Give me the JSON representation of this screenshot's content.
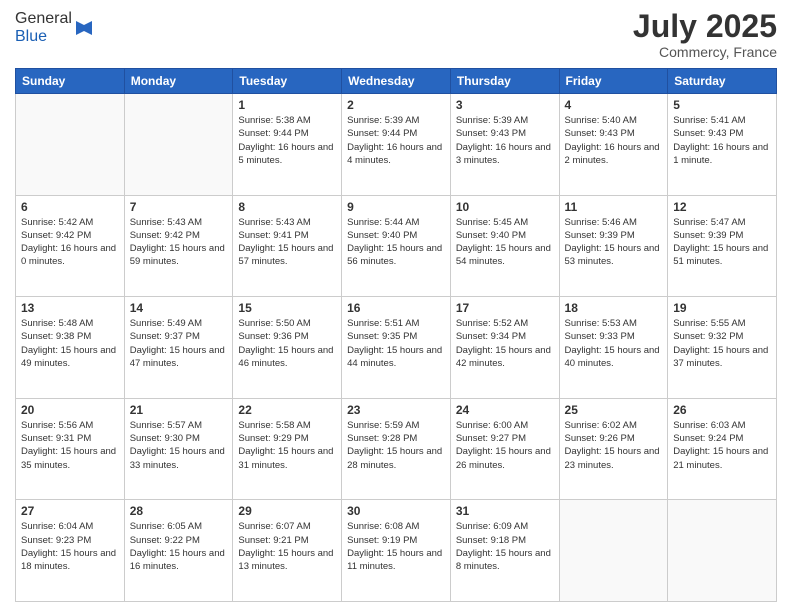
{
  "header": {
    "logo_general": "General",
    "logo_blue": "Blue",
    "month_year": "July 2025",
    "location": "Commercy, France"
  },
  "weekdays": [
    "Sunday",
    "Monday",
    "Tuesday",
    "Wednesday",
    "Thursday",
    "Friday",
    "Saturday"
  ],
  "weeks": [
    [
      {
        "day": "",
        "info": ""
      },
      {
        "day": "",
        "info": ""
      },
      {
        "day": "1",
        "info": "Sunrise: 5:38 AM\nSunset: 9:44 PM\nDaylight: 16 hours and 5 minutes."
      },
      {
        "day": "2",
        "info": "Sunrise: 5:39 AM\nSunset: 9:44 PM\nDaylight: 16 hours and 4 minutes."
      },
      {
        "day": "3",
        "info": "Sunrise: 5:39 AM\nSunset: 9:43 PM\nDaylight: 16 hours and 3 minutes."
      },
      {
        "day": "4",
        "info": "Sunrise: 5:40 AM\nSunset: 9:43 PM\nDaylight: 16 hours and 2 minutes."
      },
      {
        "day": "5",
        "info": "Sunrise: 5:41 AM\nSunset: 9:43 PM\nDaylight: 16 hours and 1 minute."
      }
    ],
    [
      {
        "day": "6",
        "info": "Sunrise: 5:42 AM\nSunset: 9:42 PM\nDaylight: 16 hours and 0 minutes."
      },
      {
        "day": "7",
        "info": "Sunrise: 5:43 AM\nSunset: 9:42 PM\nDaylight: 15 hours and 59 minutes."
      },
      {
        "day": "8",
        "info": "Sunrise: 5:43 AM\nSunset: 9:41 PM\nDaylight: 15 hours and 57 minutes."
      },
      {
        "day": "9",
        "info": "Sunrise: 5:44 AM\nSunset: 9:40 PM\nDaylight: 15 hours and 56 minutes."
      },
      {
        "day": "10",
        "info": "Sunrise: 5:45 AM\nSunset: 9:40 PM\nDaylight: 15 hours and 54 minutes."
      },
      {
        "day": "11",
        "info": "Sunrise: 5:46 AM\nSunset: 9:39 PM\nDaylight: 15 hours and 53 minutes."
      },
      {
        "day": "12",
        "info": "Sunrise: 5:47 AM\nSunset: 9:39 PM\nDaylight: 15 hours and 51 minutes."
      }
    ],
    [
      {
        "day": "13",
        "info": "Sunrise: 5:48 AM\nSunset: 9:38 PM\nDaylight: 15 hours and 49 minutes."
      },
      {
        "day": "14",
        "info": "Sunrise: 5:49 AM\nSunset: 9:37 PM\nDaylight: 15 hours and 47 minutes."
      },
      {
        "day": "15",
        "info": "Sunrise: 5:50 AM\nSunset: 9:36 PM\nDaylight: 15 hours and 46 minutes."
      },
      {
        "day": "16",
        "info": "Sunrise: 5:51 AM\nSunset: 9:35 PM\nDaylight: 15 hours and 44 minutes."
      },
      {
        "day": "17",
        "info": "Sunrise: 5:52 AM\nSunset: 9:34 PM\nDaylight: 15 hours and 42 minutes."
      },
      {
        "day": "18",
        "info": "Sunrise: 5:53 AM\nSunset: 9:33 PM\nDaylight: 15 hours and 40 minutes."
      },
      {
        "day": "19",
        "info": "Sunrise: 5:55 AM\nSunset: 9:32 PM\nDaylight: 15 hours and 37 minutes."
      }
    ],
    [
      {
        "day": "20",
        "info": "Sunrise: 5:56 AM\nSunset: 9:31 PM\nDaylight: 15 hours and 35 minutes."
      },
      {
        "day": "21",
        "info": "Sunrise: 5:57 AM\nSunset: 9:30 PM\nDaylight: 15 hours and 33 minutes."
      },
      {
        "day": "22",
        "info": "Sunrise: 5:58 AM\nSunset: 9:29 PM\nDaylight: 15 hours and 31 minutes."
      },
      {
        "day": "23",
        "info": "Sunrise: 5:59 AM\nSunset: 9:28 PM\nDaylight: 15 hours and 28 minutes."
      },
      {
        "day": "24",
        "info": "Sunrise: 6:00 AM\nSunset: 9:27 PM\nDaylight: 15 hours and 26 minutes."
      },
      {
        "day": "25",
        "info": "Sunrise: 6:02 AM\nSunset: 9:26 PM\nDaylight: 15 hours and 23 minutes."
      },
      {
        "day": "26",
        "info": "Sunrise: 6:03 AM\nSunset: 9:24 PM\nDaylight: 15 hours and 21 minutes."
      }
    ],
    [
      {
        "day": "27",
        "info": "Sunrise: 6:04 AM\nSunset: 9:23 PM\nDaylight: 15 hours and 18 minutes."
      },
      {
        "day": "28",
        "info": "Sunrise: 6:05 AM\nSunset: 9:22 PM\nDaylight: 15 hours and 16 minutes."
      },
      {
        "day": "29",
        "info": "Sunrise: 6:07 AM\nSunset: 9:21 PM\nDaylight: 15 hours and 13 minutes."
      },
      {
        "day": "30",
        "info": "Sunrise: 6:08 AM\nSunset: 9:19 PM\nDaylight: 15 hours and 11 minutes."
      },
      {
        "day": "31",
        "info": "Sunrise: 6:09 AM\nSunset: 9:18 PM\nDaylight: 15 hours and 8 minutes."
      },
      {
        "day": "",
        "info": ""
      },
      {
        "day": "",
        "info": ""
      }
    ]
  ]
}
